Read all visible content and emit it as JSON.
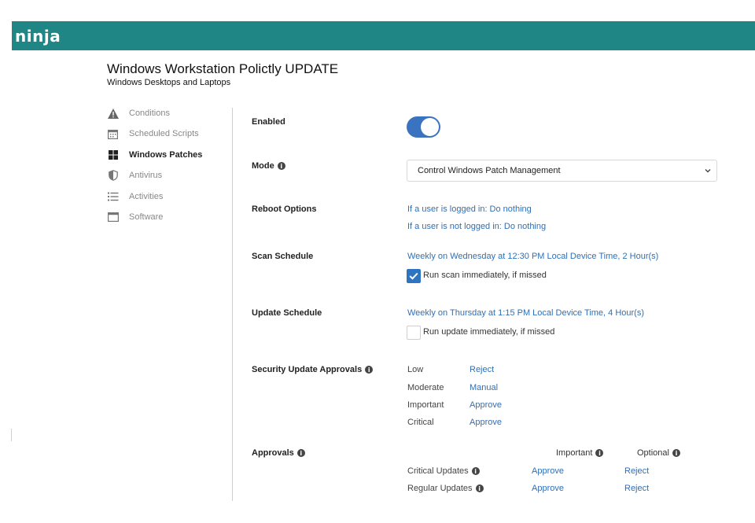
{
  "header": {
    "logo": "ninja",
    "bg_color": "#1f8585"
  },
  "page": {
    "title": "Windows Workstation Polictly UPDATE",
    "subtitle": "Windows Desktops and Laptops"
  },
  "sidebar": {
    "items": [
      {
        "label": "Conditions",
        "icon": "warning-icon",
        "active": false
      },
      {
        "label": "Scheduled Scripts",
        "icon": "calendar-icon",
        "active": false
      },
      {
        "label": "Windows Patches",
        "icon": "windows-icon",
        "active": true
      },
      {
        "label": "Antivirus",
        "icon": "shield-icon",
        "active": false
      },
      {
        "label": "Activities",
        "icon": "list-icon",
        "active": false
      },
      {
        "label": "Software",
        "icon": "window-icon",
        "active": false
      }
    ]
  },
  "settings": {
    "enabled": {
      "label": "Enabled",
      "value": true
    },
    "mode": {
      "label": "Mode",
      "value": "Control Windows Patch Management"
    },
    "reboot": {
      "label": "Reboot Options",
      "logged_in": "If a user is logged in: Do nothing",
      "not_logged_in": "If a user is not logged in: Do nothing"
    },
    "scan": {
      "label": "Scan Schedule",
      "schedule": "Weekly on Wednesday at 12:30 PM Local Device Time, 2 Hour(s)",
      "run_missed_label": "Run scan immediately, if missed",
      "run_missed": true
    },
    "update": {
      "label": "Update Schedule",
      "schedule": "Weekly on Thursday at 1:15 PM Local Device Time, 4 Hour(s)",
      "run_missed_label": "Run update immediately, if missed",
      "run_missed": false
    },
    "security": {
      "label": "Security Update Approvals",
      "rows": [
        {
          "level": "Low",
          "action": "Reject"
        },
        {
          "level": "Moderate",
          "action": "Manual"
        },
        {
          "level": "Important",
          "action": "Approve"
        },
        {
          "level": "Critical",
          "action": "Approve"
        }
      ]
    },
    "approvals": {
      "label": "Approvals",
      "col_important": "Important",
      "col_optional": "Optional",
      "rows": [
        {
          "name": "Critical Updates",
          "important": "Approve",
          "optional": "Reject"
        },
        {
          "name": "Regular Updates",
          "important": "Approve",
          "optional": "Reject"
        }
      ]
    }
  }
}
